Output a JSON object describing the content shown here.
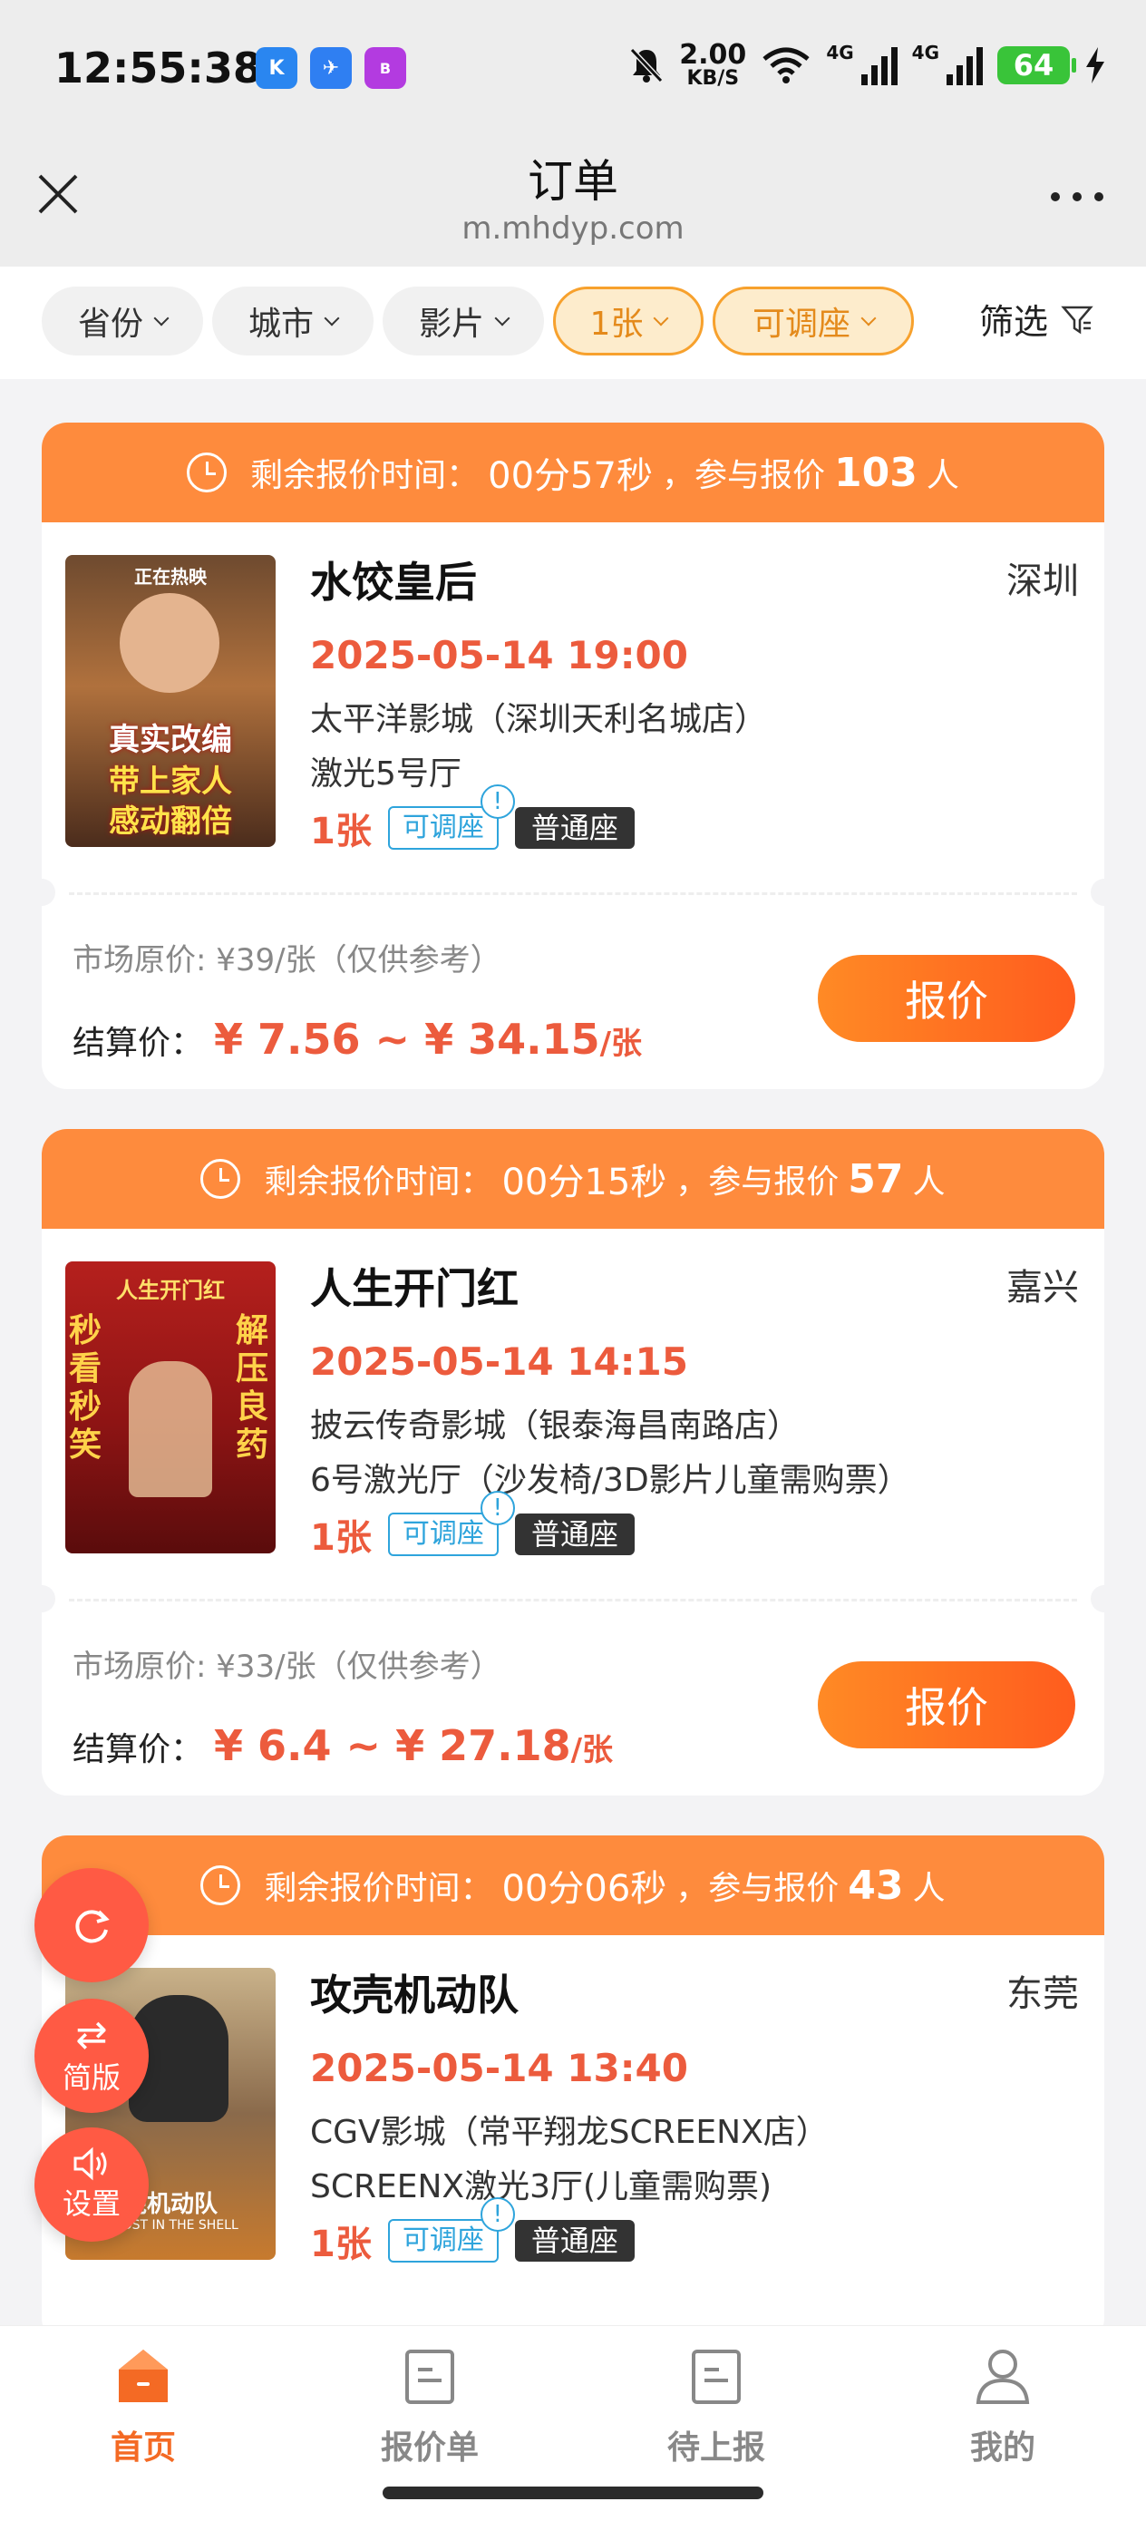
{
  "status_bar": {
    "time": "12:55:38",
    "net_speed_value": "2.00",
    "net_speed_unit": "KB/S",
    "network_label_1": "4G",
    "network_label_2": "4G",
    "battery": "64",
    "app_icons": [
      "k-app-icon",
      "bird-app-icon",
      "bank-app-icon"
    ]
  },
  "header": {
    "title": "订单",
    "domain": "m.mhdyp.com"
  },
  "filters": {
    "chips": [
      {
        "label": "省份",
        "active": false
      },
      {
        "label": "城市",
        "active": false
      },
      {
        "label": "影片",
        "active": false
      },
      {
        "label": "1张",
        "active": true
      },
      {
        "label": "可调座",
        "active": true
      }
    ],
    "filter_label": "筛选"
  },
  "banner_text": {
    "prefix": "剩余报价时间：",
    "middle": "，参与报价",
    "suffix": "人"
  },
  "orders": [
    {
      "countdown": "00分57秒",
      "participants": "103",
      "movie": "水饺皇后",
      "city": "深圳",
      "showtime": "2025-05-14 19:00",
      "cinema": "太平洋影城（深圳天利名城店）",
      "hall": "激光5号厅",
      "quantity": "1张",
      "adjustable_tag": "可调座",
      "seat_tag": "普通座",
      "market_price": "市场原价: ¥39/张（仅供参考）",
      "settle_label": "结算价：",
      "settle_range": "¥ 7.56 ~ ¥ 34.15",
      "settle_unit": "/张",
      "quote_button": "报价",
      "poster_text": [
        "正在热映",
        "真实改编",
        "带上家人",
        "感动翻倍"
      ]
    },
    {
      "countdown": "00分15秒",
      "participants": "57",
      "movie": "人生开门红",
      "city": "嘉兴",
      "showtime": "2025-05-14 14:15",
      "cinema": "披云传奇影城（银泰海昌南路店）",
      "hall": "6号激光厅（沙发椅/3D影片儿童需购票）",
      "quantity": "1张",
      "adjustable_tag": "可调座",
      "seat_tag": "普通座",
      "market_price": "市场原价: ¥33/张（仅供参考）",
      "settle_label": "结算价：",
      "settle_range": "¥ 6.4 ~ ¥ 27.18",
      "settle_unit": "/张",
      "quote_button": "报价",
      "poster_text": [
        "人生开门红",
        "秒看秒笑",
        "解压良药"
      ]
    },
    {
      "countdown": "00分06秒",
      "participants": "43",
      "movie": "攻壳机动队",
      "city": "东莞",
      "showtime": "2025-05-14 13:40",
      "cinema": "CGV影城（常平翔龙SCREENX店）",
      "hall": "SCREENX激光3厅(儿童需购票)",
      "quantity": "1张",
      "adjustable_tag": "可调座",
      "seat_tag": "普通座",
      "poster_text": [
        "壳机动队",
        "GHOST IN THE SHELL"
      ]
    }
  ],
  "floating": {
    "refresh_icon": "refresh-icon",
    "simple_label": "简版",
    "settings_label": "设置"
  },
  "tabbar": {
    "tabs": [
      {
        "label": "首页",
        "icon": "home-icon",
        "active": true
      },
      {
        "label": "报价单",
        "icon": "document-icon",
        "active": false
      },
      {
        "label": "待上报",
        "icon": "document-icon",
        "active": false
      },
      {
        "label": "我的",
        "icon": "user-icon",
        "active": false
      }
    ]
  },
  "colors": {
    "accent": "#fe8b3d",
    "price_red": "#ec5b3d",
    "tab_active": "#f46a24",
    "tag_blue": "#2ea4dc"
  }
}
